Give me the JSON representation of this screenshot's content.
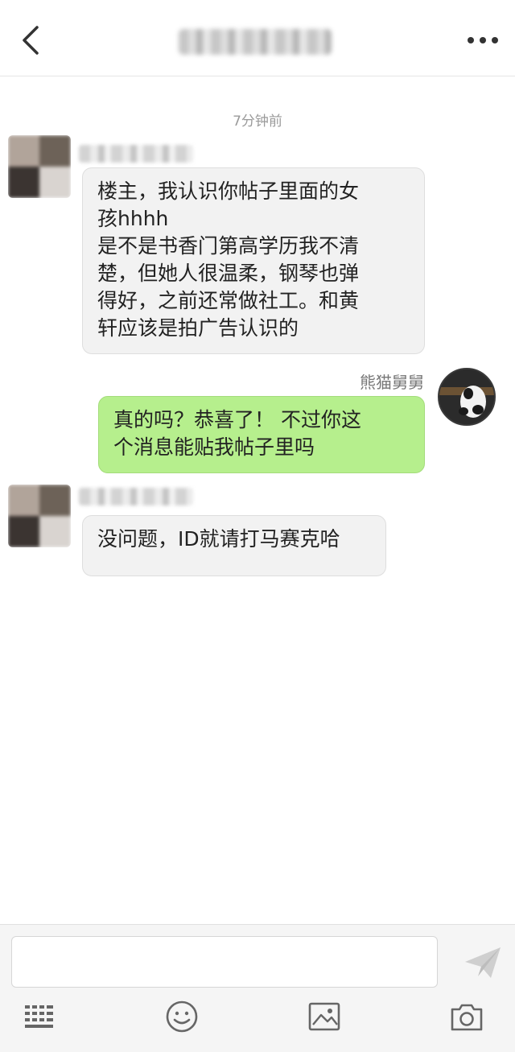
{
  "header": {
    "back_icon": "chevron-left-icon",
    "more_icon": "ellipsis-icon"
  },
  "chat": {
    "timestamp": "7分钟前",
    "messages": [
      {
        "side": "left",
        "text": "楼主，我认识你帖子里面的女\n孩hhhh\n是不是书香门第高学历我不清\n楚，但她人很温柔，钢琴也弹\n得好，之前还常做社工。和黄\n轩应该是拍广告认识的"
      },
      {
        "side": "right",
        "sender": "熊猫舅舅",
        "text": "真的吗？恭喜了！ 不过你这\n个消息能贴我帖子里吗"
      },
      {
        "side": "left",
        "text": "没问题，ID就请打马赛克哈"
      }
    ]
  },
  "composer": {
    "input_value": "",
    "send_icon": "paper-plane-icon",
    "tools": [
      "keyboard-icon",
      "emoji-icon",
      "image-icon",
      "camera-icon"
    ]
  },
  "colors": {
    "bubble_me": "#b6ef8d",
    "bubble_other": "#f2f2f2"
  }
}
